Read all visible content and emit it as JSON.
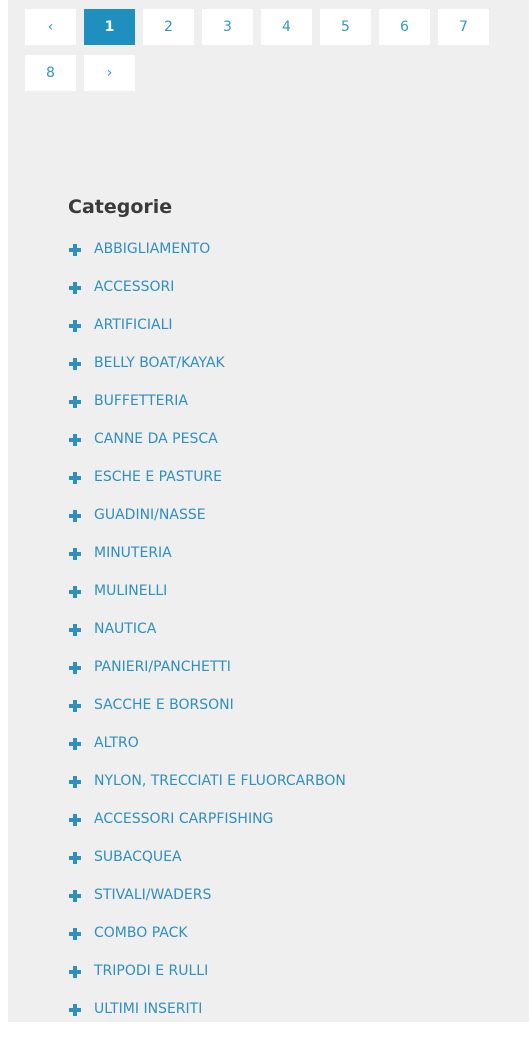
{
  "pagination": {
    "prev_label": "‹",
    "next_label": "›",
    "pages": [
      "1",
      "2",
      "3",
      "4",
      "5",
      "6",
      "7",
      "8"
    ],
    "current_page": 1
  },
  "categories": {
    "title": "Categorie",
    "items": [
      "ABBIGLIAMENTO",
      "ACCESSORI",
      "ARTIFICIALI",
      "BELLY BOAT/KAYAK",
      "BUFFETTERIA",
      "CANNE DA PESCA",
      "ESCHE E PASTURE",
      "GUADINI/NASSE",
      "MINUTERIA",
      "MULINELLI",
      "NAUTICA",
      "PANIERI/PANCHETTI",
      "SACCHE E BORSONI",
      "ALTRO",
      "NYLON, TRECCIATI E FLUORCARBON",
      "ACCESSORI CARPFISHING",
      "SUBACQUEA",
      "STIVALI/WADERS",
      "COMBO PACK",
      "TRIPODI E RULLI",
      "ULTIMI INSERITI"
    ],
    "icon": "plus-icon"
  },
  "colors": {
    "accent": "#1f8fbf",
    "link": "#2f8fbe",
    "panel_bg": "#efefef"
  }
}
